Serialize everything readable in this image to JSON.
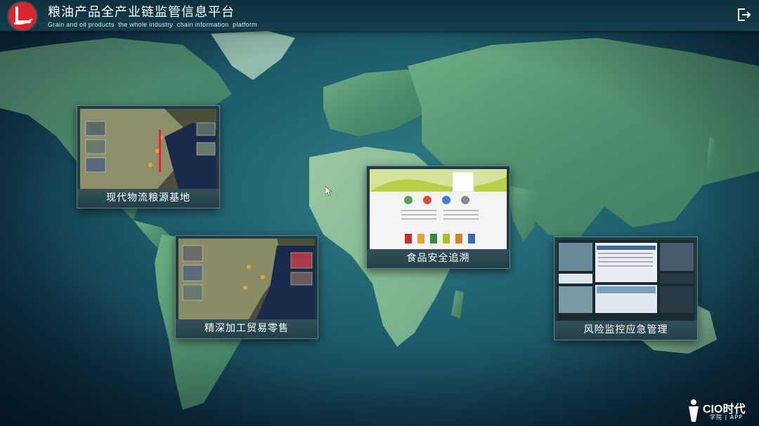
{
  "header": {
    "title": "粮油产品全产业链监管信息平台",
    "subtitle": "Grain and oil products  the whole industry  chain information  platform",
    "exit_icon": "exit-icon"
  },
  "cards": [
    {
      "label": "现代物流粮源基地"
    },
    {
      "label": "精深加工贸易零售"
    },
    {
      "label": "食品安全追溯"
    },
    {
      "label": "风险监控应急管理"
    }
  ],
  "watermark": {
    "text": "CIO时代",
    "sub": "学院 | APP"
  },
  "colors": {
    "logo": "#d8262b",
    "header_bg": "#143d4c",
    "ocean": "#1d5b6a",
    "land": "#5a9c78"
  }
}
